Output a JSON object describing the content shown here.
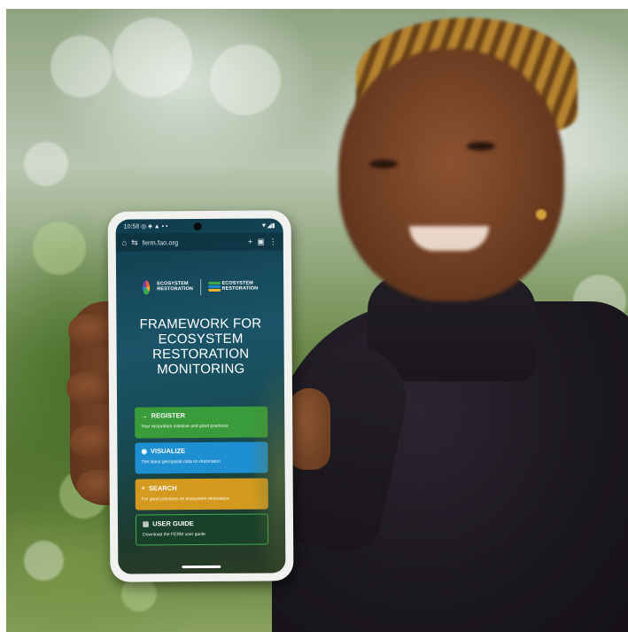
{
  "statusbar": {
    "time": "10:58",
    "left_icons": "◎ ♣ ▲ ▪ •",
    "right_icons": "▼◢▮"
  },
  "browser": {
    "url": "ferm.fao.org",
    "home_icon": "⌂",
    "site_icon": "⇆",
    "add_icon": "+",
    "tabs_icon": "▣",
    "menu_icon": "⋮"
  },
  "logos": {
    "logo1_text": "ECOSYSTEM\nRESTORATION",
    "logo2_text": "ECOSYSTEM\nRESTORATION"
  },
  "hero": {
    "title": "FRAMEWORK FOR ECOSYSTEM RESTORATION MONITORING"
  },
  "cards": {
    "register": {
      "icon": "→",
      "title": "REGISTER",
      "subtitle": "Your restoration initiative and good practices"
    },
    "visualize": {
      "icon": "◉",
      "title": "VISUALIZE",
      "subtitle": "The latest geospatial data on restoration"
    },
    "search": {
      "icon": "⌕",
      "title": "SEARCH",
      "subtitle": "For good practices on ecosystem restoration"
    },
    "guide": {
      "icon": "▤",
      "title": "USER GUIDE",
      "subtitle": "Download the FERM user guide"
    }
  },
  "colors": {
    "register": "#3a9b3a",
    "visualize": "#1e8fd0",
    "search": "#d49a1f",
    "guide_border": "#3fae49"
  }
}
